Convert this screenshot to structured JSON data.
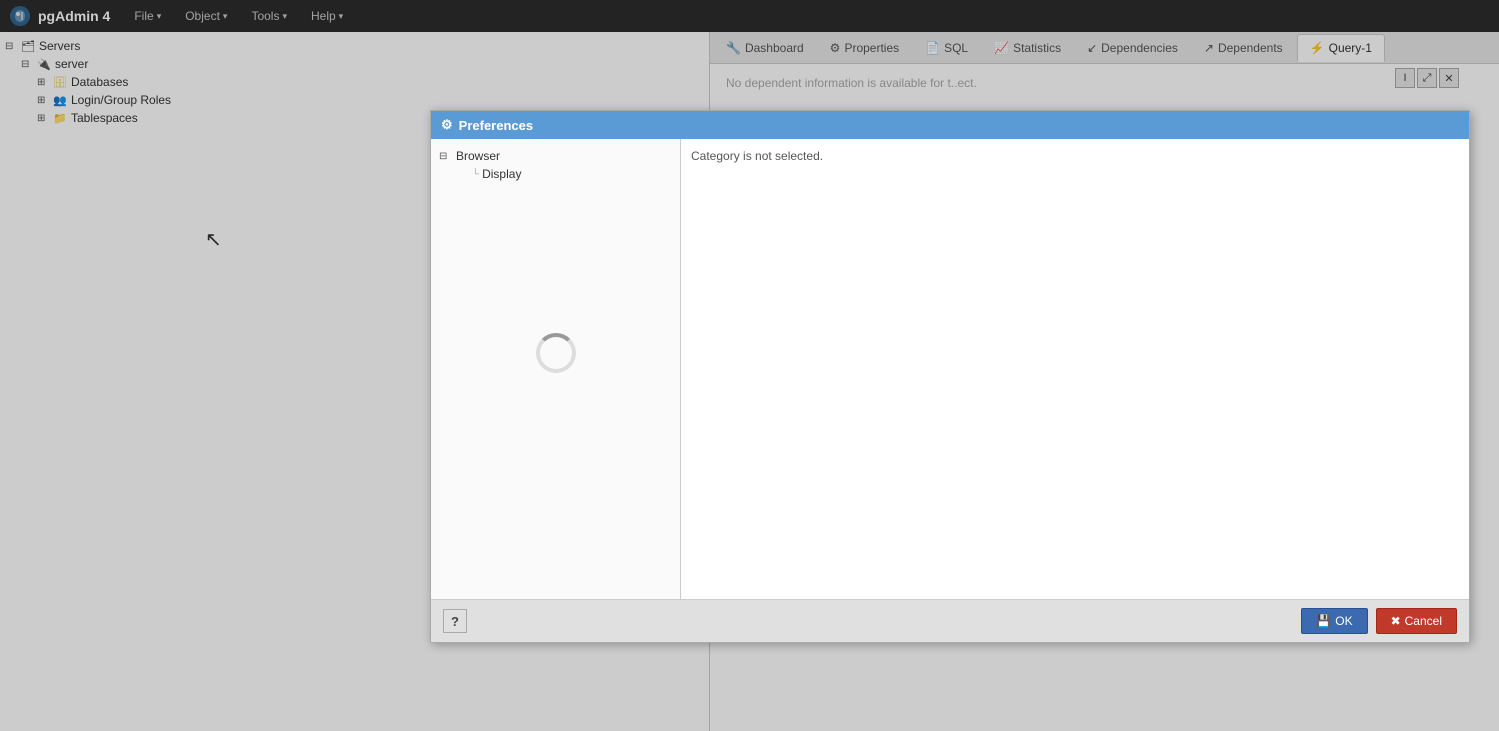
{
  "app": {
    "title": "pgAdmin 4",
    "logo_alt": "pgAdmin logo"
  },
  "menubar": {
    "items": [
      {
        "label": "File",
        "id": "file"
      },
      {
        "label": "Object",
        "id": "object"
      },
      {
        "label": "Tools",
        "id": "tools"
      },
      {
        "label": "Help",
        "id": "help"
      }
    ]
  },
  "tree": {
    "items": [
      {
        "id": "servers",
        "label": "Servers",
        "level": 0,
        "expand": "⊟",
        "icon": "server-group"
      },
      {
        "id": "server",
        "label": "server",
        "level": 1,
        "expand": "⊟",
        "icon": "server"
      },
      {
        "id": "databases",
        "label": "Databases",
        "level": 2,
        "expand": "⊞",
        "icon": "databases"
      },
      {
        "id": "login-roles",
        "label": "Login/Group Roles",
        "level": 2,
        "expand": "⊞",
        "icon": "roles"
      },
      {
        "id": "tablespaces",
        "label": "Tablespaces",
        "level": 2,
        "expand": "⊞",
        "icon": "tablespaces"
      }
    ]
  },
  "tabs": [
    {
      "id": "dashboard",
      "label": "Dashboard",
      "icon": "🔧",
      "active": false
    },
    {
      "id": "properties",
      "label": "Properties",
      "icon": "⚙️",
      "active": false
    },
    {
      "id": "sql",
      "label": "SQL",
      "icon": "📄",
      "active": false
    },
    {
      "id": "statistics",
      "label": "Statistics",
      "icon": "📈",
      "active": false
    },
    {
      "id": "dependencies",
      "label": "Dependencies",
      "icon": "↙",
      "active": false
    },
    {
      "id": "dependents",
      "label": "Dependents",
      "icon": "↗",
      "active": false
    },
    {
      "id": "query1",
      "label": "Query-1",
      "icon": "⚡",
      "active": true
    }
  ],
  "right_panel": {
    "no_info_text": "No dependent information is available for t..ect."
  },
  "preferences_dialog": {
    "title": "Preferences",
    "category_not_selected": "Category is not selected.",
    "tree": [
      {
        "id": "browser",
        "label": "Browser",
        "level": 0,
        "expand": "⊟"
      },
      {
        "id": "display",
        "label": "Display",
        "level": 1,
        "expand": ""
      }
    ],
    "footer": {
      "help_label": "?",
      "ok_label": "OK",
      "cancel_label": "Cancel",
      "ok_icon": "💾",
      "cancel_icon": "✖"
    }
  }
}
